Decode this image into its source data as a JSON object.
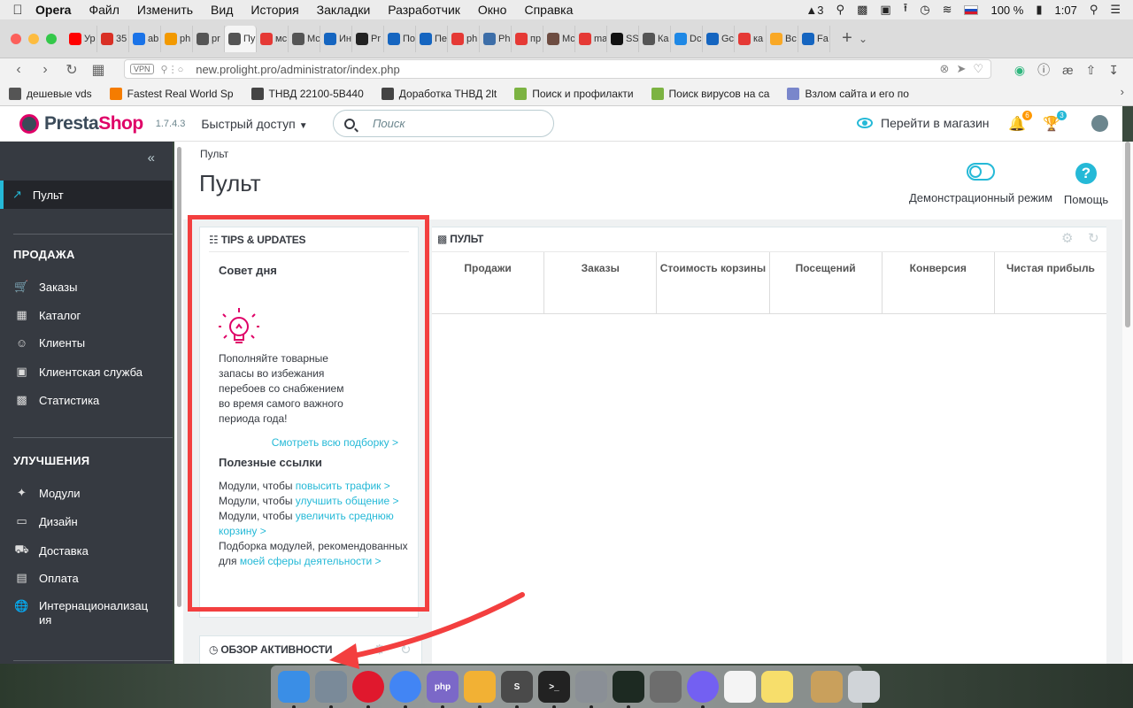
{
  "menubar": {
    "app": "Opera",
    "items": [
      "Файл",
      "Изменить",
      "Вид",
      "История",
      "Закладки",
      "Разработчик",
      "Окно",
      "Справка"
    ],
    "status": {
      "num": "3",
      "battery": "100 %",
      "time": "1:07"
    }
  },
  "tabs": [
    {
      "label": "Ур",
      "color": "#ff0000",
      "icon": "youtube-icon"
    },
    {
      "label": "35",
      "color": "#d93025",
      "icon": "mail-icon"
    },
    {
      "label": "ab",
      "color": "#1a73e8",
      "icon": "check-icon"
    },
    {
      "label": "ph",
      "color": "#f29900",
      "icon": "hosting-icon"
    },
    {
      "label": "pr",
      "color": "#555555",
      "icon": "prestashop-icon"
    },
    {
      "label": "Пу",
      "color": "#555555",
      "icon": "prestashop-icon",
      "active": true
    },
    {
      "label": "мс",
      "color": "#e53935",
      "icon": "yandex-icon"
    },
    {
      "label": "Мс",
      "color": "#555555",
      "icon": "document-icon"
    },
    {
      "label": "Ин",
      "color": "#1565c0",
      "icon": "bracket-icon"
    },
    {
      "label": "Pr",
      "color": "#222222",
      "icon": "terminal-icon"
    },
    {
      "label": "По",
      "color": "#1565c0",
      "icon": "bracket-icon"
    },
    {
      "label": "Пе",
      "color": "#1565c0",
      "icon": "bracket-icon"
    },
    {
      "label": "ph",
      "color": "#e53935",
      "icon": "yandex-icon"
    },
    {
      "label": "Ph",
      "color": "#3d6ea8",
      "icon": "h-icon"
    },
    {
      "label": "пр",
      "color": "#e53935",
      "icon": "yandex-icon"
    },
    {
      "label": "Мс",
      "color": "#6d4c41",
      "icon": "photo-icon"
    },
    {
      "label": "ma",
      "color": "#e53935",
      "icon": "yandex-icon"
    },
    {
      "label": "SS",
      "color": "#111111",
      "icon": "github-icon"
    },
    {
      "label": "Ка",
      "color": "#555555",
      "icon": "document-icon"
    },
    {
      "label": "Dc",
      "color": "#1e88e5",
      "icon": "globe-icon"
    },
    {
      "label": "Gc",
      "color": "#1565c0",
      "icon": "php-icon"
    },
    {
      "label": "ка",
      "color": "#e53935",
      "icon": "yandex-icon"
    },
    {
      "label": "Вс",
      "color": "#f9a825",
      "icon": "coin-icon"
    },
    {
      "label": "Fa",
      "color": "#1565c0",
      "icon": "fa-icon"
    }
  ],
  "address": {
    "vpn": "VPN",
    "url": "new.prolight.pro/administrator/index.php"
  },
  "bookmarks": [
    {
      "label": "дешевые vds",
      "color": "#555555"
    },
    {
      "label": "Fastest Real World Sp",
      "color": "#f57c00"
    },
    {
      "label": "ТНВД 22100-5В440",
      "color": "#444444"
    },
    {
      "label": "Доработка ТНВД 2lt",
      "color": "#444444"
    },
    {
      "label": "Поиск и профилакти",
      "color": "#7cb342"
    },
    {
      "label": "Поиск вирусов на са",
      "color": "#7cb342"
    },
    {
      "label": "Взлом сайта и его по",
      "color": "#7986cb"
    }
  ],
  "header": {
    "brand_a": "Presta",
    "brand_b": "Shop",
    "version": "1.7.4.3",
    "quick_access": "Быстрый доступ",
    "search_placeholder": "Поиск",
    "go_store": "Перейти в магазин",
    "notif_count": "6",
    "orders_count": "3"
  },
  "sidebar": {
    "active": "Пульт",
    "sections": [
      {
        "title": "ПРОДАЖА",
        "items": [
          {
            "label": "Заказы",
            "icon": "cart-icon"
          },
          {
            "label": "Каталог",
            "icon": "store-icon"
          },
          {
            "label": "Клиенты",
            "icon": "user-icon"
          },
          {
            "label": "Клиентская служба",
            "icon": "chat-icon"
          },
          {
            "label": "Статистика",
            "icon": "chart-icon"
          }
        ]
      },
      {
        "title": "УЛУЧШЕНИЯ",
        "items": [
          {
            "label": "Модули",
            "icon": "puzzle-icon"
          },
          {
            "label": "Дизайн",
            "icon": "monitor-icon"
          },
          {
            "label": "Доставка",
            "icon": "truck-icon"
          },
          {
            "label": "Оплата",
            "icon": "card-icon"
          },
          {
            "label": "Интернационализация",
            "icon": "globe-icon"
          }
        ]
      }
    ]
  },
  "page": {
    "breadcrumb": "Пульт",
    "title": "Пульт",
    "demo_mode": "Демонстрационный режим",
    "help": "Помощь"
  },
  "tips": {
    "heading": "TIPS & UPDATES",
    "tip_title": "Совет дня",
    "tip_text": "Пополняйте товарные запасы во избежания перебоев со снабжением во время самого важного периода года!",
    "see_all": "Смотреть всю подборку >",
    "links_title": "Полезные ссылки",
    "link1_prefix": "Модули, чтобы ",
    "link1": "повысить трафик >",
    "link2_prefix": "Модули, чтобы ",
    "link2": "улучшить общение >",
    "link3_prefix": "Модули, чтобы ",
    "link3": "увеличить среднюю корзину >",
    "link4_prefix": "Подборка модулей, рекомендованных для ",
    "link4": "моей сферы деятельности >"
  },
  "activity": {
    "heading": "ОБЗОР АКТИВНОСТИ"
  },
  "dashboard": {
    "heading": "ПУЛЬТ",
    "kpis": [
      "Продажи",
      "Заказы",
      "Стоимость корзины",
      "Посещений",
      "Конверсия",
      "Чистая прибыль"
    ]
  },
  "dock": [
    {
      "icon": "finder-icon",
      "color": "#3a8ee6",
      "label": ""
    },
    {
      "icon": "launchpad-icon",
      "color": "#7a8a99",
      "label": ""
    },
    {
      "icon": "opera-icon",
      "color": "#e0182d",
      "label": ""
    },
    {
      "icon": "chrome-icon",
      "color": "#4285f4",
      "label": ""
    },
    {
      "icon": "phpstorm-icon",
      "color": "#7b68c8",
      "label": "php"
    },
    {
      "icon": "transmit-icon",
      "color": "#f2b134",
      "label": ""
    },
    {
      "icon": "sublime-icon",
      "color": "#4a4a4a",
      "label": "S"
    },
    {
      "icon": "terminal-icon",
      "color": "#222222",
      "label": ">_"
    },
    {
      "icon": "system-preferences-icon",
      "color": "#8a8f96",
      "label": ""
    },
    {
      "icon": "activity-monitor-icon",
      "color": "#1d2a22",
      "label": ""
    },
    {
      "icon": "calculator-icon",
      "color": "#6d6d6d",
      "label": ""
    },
    {
      "icon": "viber-icon",
      "color": "#7360f2",
      "label": ""
    },
    {
      "icon": "textedit-icon",
      "color": "#f4f4f4",
      "label": ""
    },
    {
      "icon": "notes-icon",
      "color": "#f7de6b",
      "label": ""
    },
    {
      "icon": "archive-utility-icon",
      "color": "#c9a05c",
      "label": ""
    },
    {
      "icon": "trash-icon",
      "color": "#d0d4d8",
      "label": ""
    }
  ]
}
